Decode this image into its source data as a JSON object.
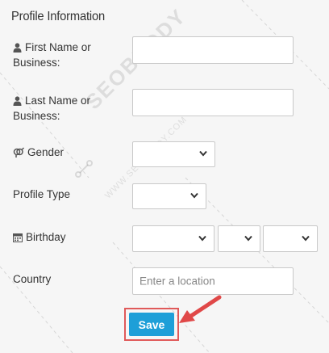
{
  "form": {
    "title": "Profile Information",
    "first_name": {
      "label_line1": "First Name or",
      "label_line2": "Business:",
      "icon": "user-icon",
      "value": ""
    },
    "last_name": {
      "label_line1": "Last Name or",
      "label_line2": "Business:",
      "icon": "user-icon",
      "value": ""
    },
    "gender": {
      "label": "Gender",
      "icon": "gender-icon",
      "value": ""
    },
    "profile_type": {
      "label": "Profile Type",
      "value": ""
    },
    "birthday": {
      "label": "Birthday",
      "icon": "calendar-icon",
      "month": "",
      "day": "",
      "year": ""
    },
    "country": {
      "label": "Country",
      "placeholder": "Enter a location",
      "value": ""
    },
    "save_label": "Save"
  },
  "watermark": {
    "brand": "SEOBUDDY",
    "url": "WWW.SEOBUDDY.COM"
  },
  "colors": {
    "accent": "#1e9fd8",
    "highlight": "#e05a5a",
    "background": "#f6f6f6"
  }
}
